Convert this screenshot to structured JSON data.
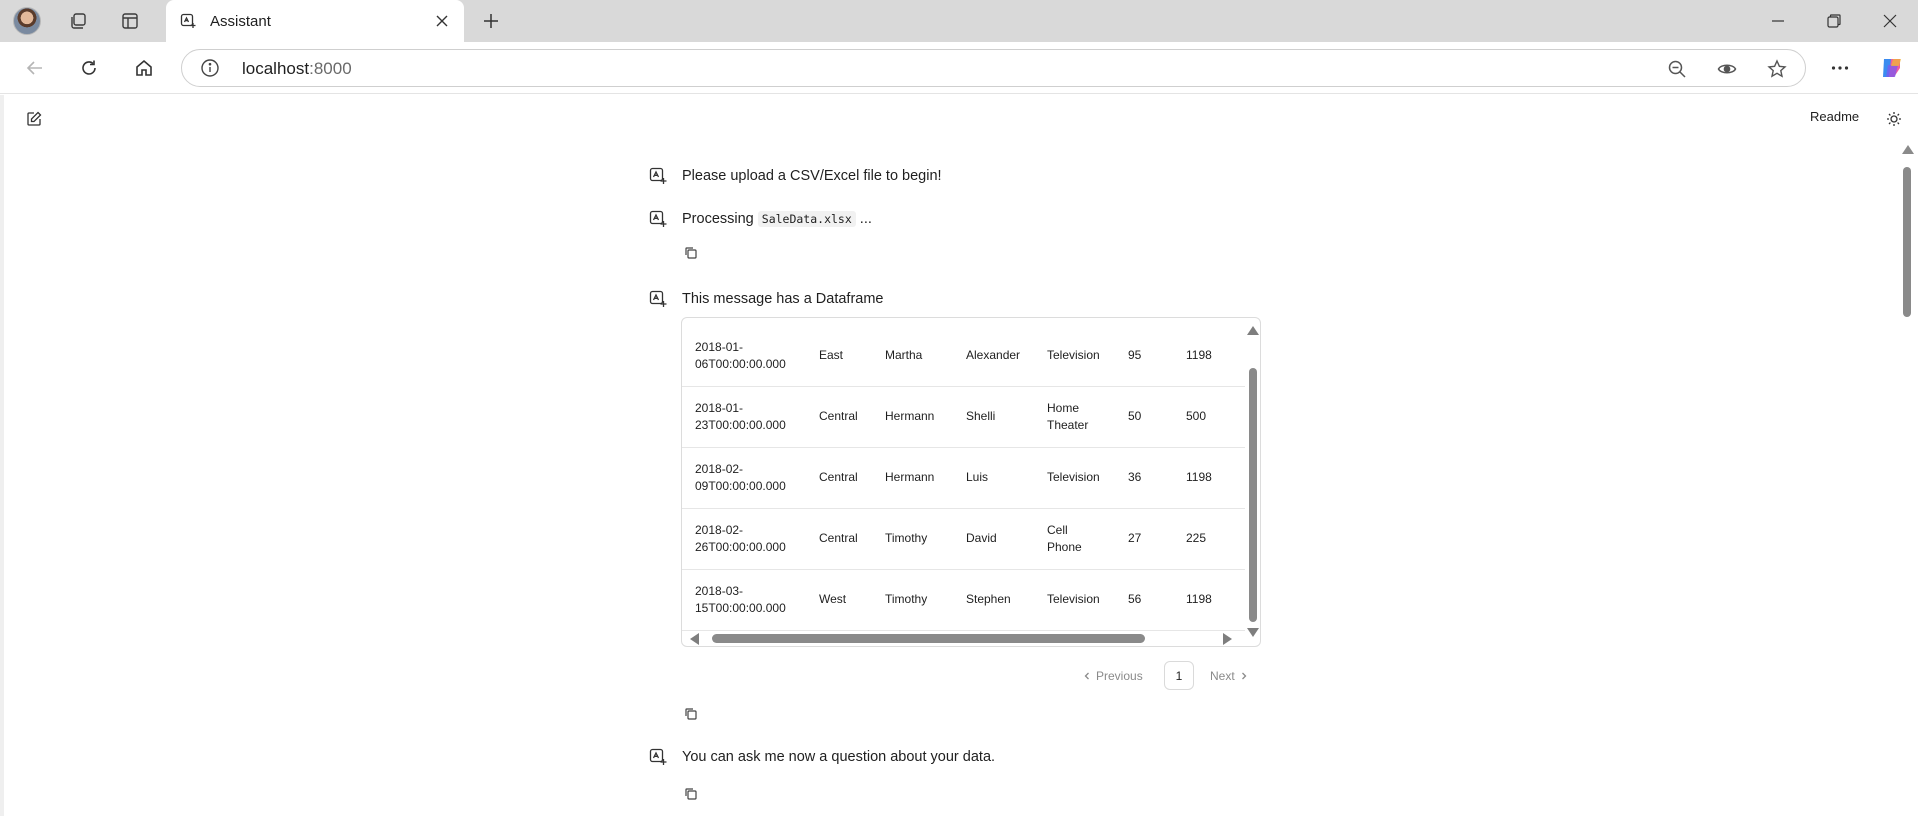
{
  "browser": {
    "tab_title": "Assistant",
    "url_host": "localhost",
    "url_port": ":8000"
  },
  "app": {
    "readme_label": "Readme",
    "messages": {
      "m1": "Please upload a CSV/Excel file to begin!",
      "m2_prefix": "Processing ",
      "m2_file": "SaleData.xlsx",
      "m2_suffix": " ...",
      "m3": "This message has a Dataframe",
      "m4": "You can ask me now a question about your data."
    },
    "dataframe": {
      "rows": [
        {
          "date1": "2018-01-",
          "date2": "06T00:00:00.000",
          "region": "East",
          "manager": "Martha",
          "salesman": "Alexander",
          "item1": "Television",
          "item2": "",
          "units": "95",
          "unit_price": "1198"
        },
        {
          "date1": "2018-01-",
          "date2": "23T00:00:00.000",
          "region": "Central",
          "manager": "Hermann",
          "salesman": "Shelli",
          "item1": "Home",
          "item2": "Theater",
          "units": "50",
          "unit_price": "500"
        },
        {
          "date1": "2018-02-",
          "date2": "09T00:00:00.000",
          "region": "Central",
          "manager": "Hermann",
          "salesman": "Luis",
          "item1": "Television",
          "item2": "",
          "units": "36",
          "unit_price": "1198"
        },
        {
          "date1": "2018-02-",
          "date2": "26T00:00:00.000",
          "region": "Central",
          "manager": "Timothy",
          "salesman": "David",
          "item1": "Cell",
          "item2": "Phone",
          "units": "27",
          "unit_price": "225"
        },
        {
          "date1": "2018-03-",
          "date2": "15T00:00:00.000",
          "region": "West",
          "manager": "Timothy",
          "salesman": "Stephen",
          "item1": "Television",
          "item2": "",
          "units": "56",
          "unit_price": "1198"
        }
      ]
    },
    "pagination": {
      "prev_label": "Previous",
      "page": "1",
      "next_label": "Next"
    }
  }
}
